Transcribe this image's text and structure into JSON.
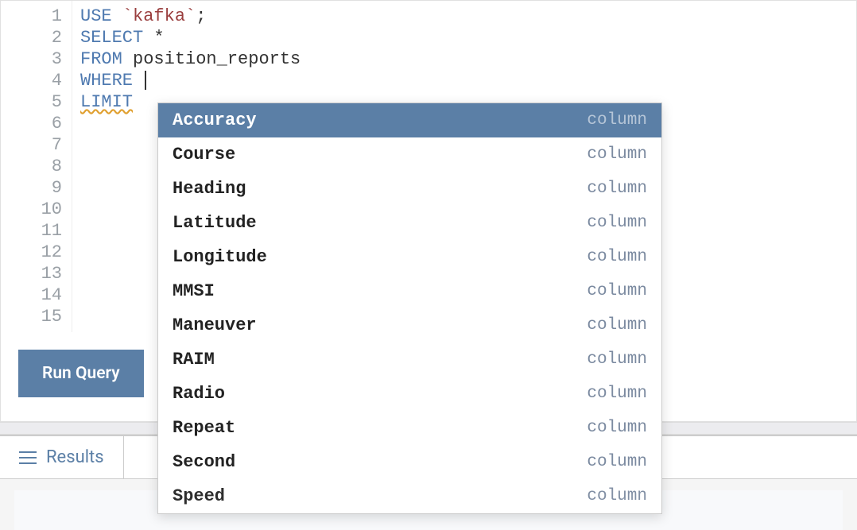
{
  "editor": {
    "lines": [
      {
        "tokens": [
          {
            "t": "kw",
            "v": "USE"
          },
          {
            "t": "sp",
            "v": " "
          },
          {
            "t": "bt",
            "v": "`kafka`"
          },
          {
            "t": "punc",
            "v": ";"
          }
        ]
      },
      {
        "tokens": [
          {
            "t": "kw",
            "v": "SELECT"
          },
          {
            "t": "sp",
            "v": " "
          },
          {
            "t": "punc",
            "v": "*"
          }
        ]
      },
      {
        "tokens": [
          {
            "t": "kw",
            "v": "FROM"
          },
          {
            "t": "sp",
            "v": " "
          },
          {
            "t": "ident",
            "v": "position_reports"
          }
        ]
      },
      {
        "tokens": [
          {
            "t": "kw",
            "v": "WHERE"
          },
          {
            "t": "sp",
            "v": " "
          },
          {
            "t": "cursor",
            "v": ""
          }
        ]
      },
      {
        "tokens": [
          {
            "t": "kw-warn",
            "v": "LIMIT"
          }
        ]
      }
    ],
    "gutter_count": 15
  },
  "runButton": {
    "label": "Run Query"
  },
  "resultsTab": {
    "label": "Results"
  },
  "autocomplete": {
    "items": [
      {
        "label": "Accuracy",
        "type": "column",
        "selected": true
      },
      {
        "label": "Course",
        "type": "column",
        "selected": false
      },
      {
        "label": "Heading",
        "type": "column",
        "selected": false
      },
      {
        "label": "Latitude",
        "type": "column",
        "selected": false
      },
      {
        "label": "Longitude",
        "type": "column",
        "selected": false
      },
      {
        "label": "MMSI",
        "type": "column",
        "selected": false
      },
      {
        "label": "Maneuver",
        "type": "column",
        "selected": false
      },
      {
        "label": "RAIM",
        "type": "column",
        "selected": false
      },
      {
        "label": "Radio",
        "type": "column",
        "selected": false
      },
      {
        "label": "Repeat",
        "type": "column",
        "selected": false
      },
      {
        "label": "Second",
        "type": "column",
        "selected": false
      },
      {
        "label": "Speed",
        "type": "column",
        "selected": false,
        "partial": true
      }
    ]
  }
}
